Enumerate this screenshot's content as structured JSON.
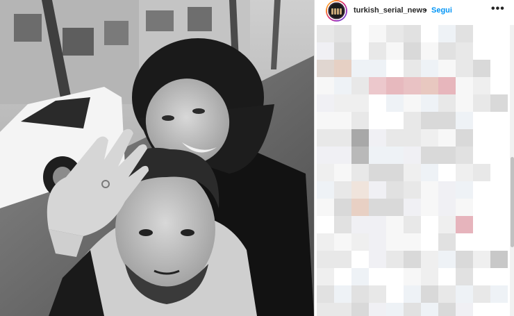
{
  "post": {
    "username": "turkish_serial_news",
    "separator": "•",
    "follow_label": "Segui",
    "more_label": "•••"
  },
  "icons": {
    "more": "more-options-icon",
    "avatar": "profile-avatar"
  },
  "colors": {
    "follow": "#0095f6",
    "text": "#262626",
    "border": "#dbdbdb"
  }
}
